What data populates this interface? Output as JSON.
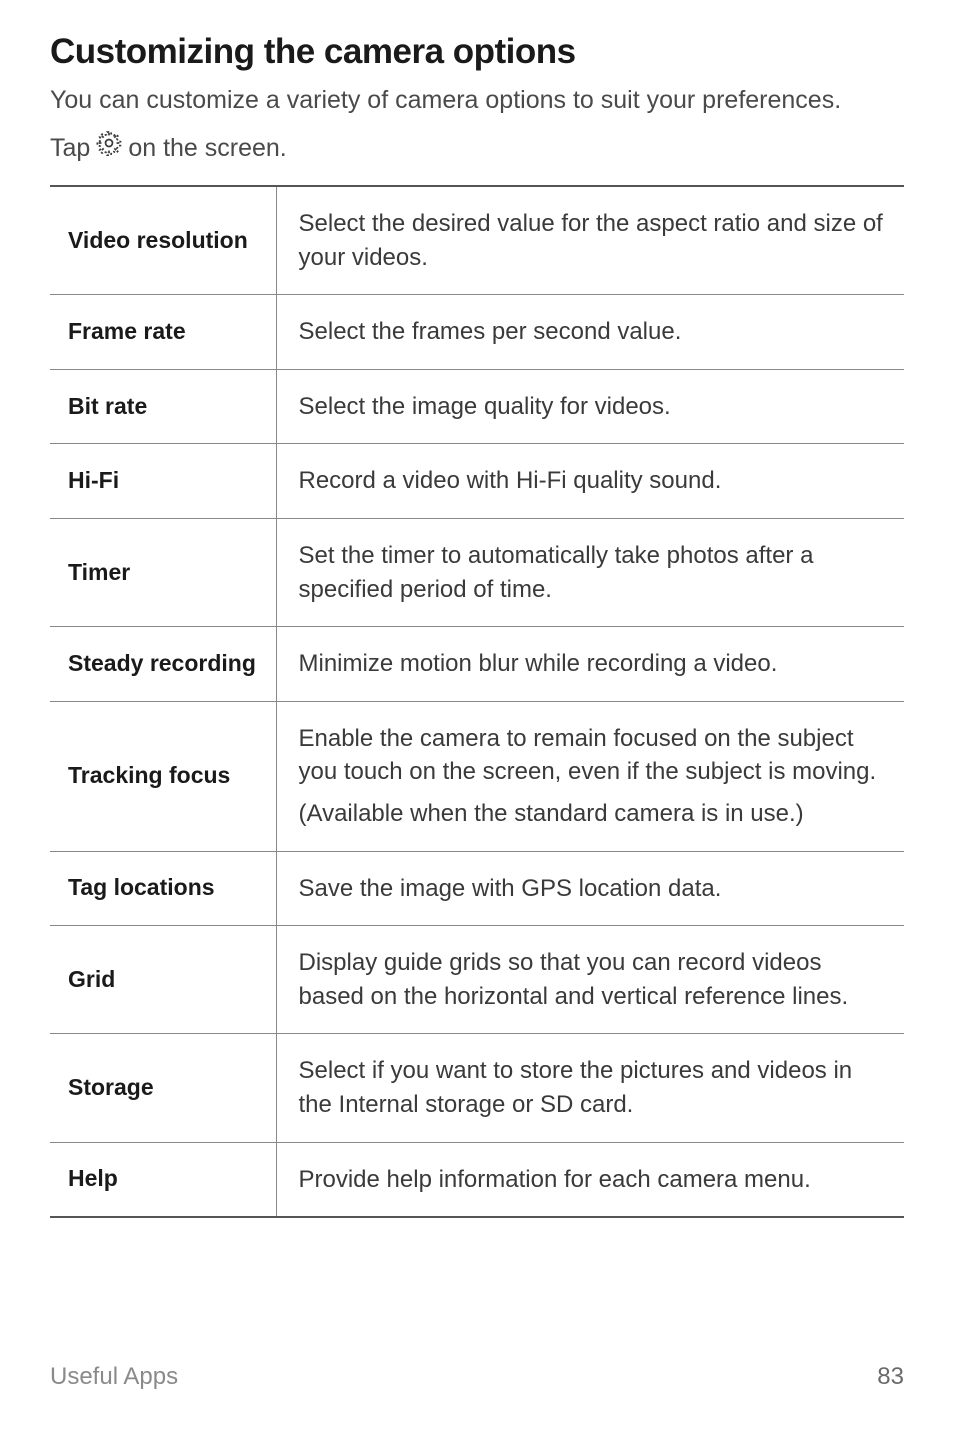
{
  "heading": "Customizing the camera options",
  "intro": "You can customize a variety of camera options to suit your preferences.",
  "tap_prefix": "Tap ",
  "tap_suffix": " on the screen.",
  "gear_icon_name": "settings-gear-icon",
  "rows": [
    {
      "name": "Video resolution",
      "desc": [
        "Select the desired value for the aspect ratio and size of your videos."
      ]
    },
    {
      "name": "Frame rate",
      "desc": [
        "Select the frames per second value."
      ]
    },
    {
      "name": "Bit rate",
      "desc": [
        "Select the image quality for videos."
      ]
    },
    {
      "name": "Hi-Fi",
      "desc": [
        "Record a video with Hi-Fi quality sound."
      ]
    },
    {
      "name": "Timer",
      "desc": [
        "Set the timer to automatically take photos after a specified period of time."
      ]
    },
    {
      "name": "Steady recording",
      "desc": [
        "Minimize motion blur while recording a video."
      ]
    },
    {
      "name": "Tracking focus",
      "desc": [
        "Enable the camera to remain focused on the subject you touch on the screen, even if the subject is moving.",
        "(Available when the standard camera is in use.)"
      ]
    },
    {
      "name": "Tag locations",
      "desc": [
        "Save the image with GPS location data."
      ]
    },
    {
      "name": "Grid",
      "desc": [
        "Display guide grids so that you can record videos based on the horizontal and vertical reference lines."
      ]
    },
    {
      "name": "Storage",
      "desc": [
        "Select if you want to store the pictures and videos in the Internal storage or SD card."
      ]
    },
    {
      "name": "Help",
      "desc": [
        "Provide help information for each camera menu."
      ]
    }
  ],
  "footer": {
    "section_label": "Useful Apps",
    "page_number": "83"
  }
}
